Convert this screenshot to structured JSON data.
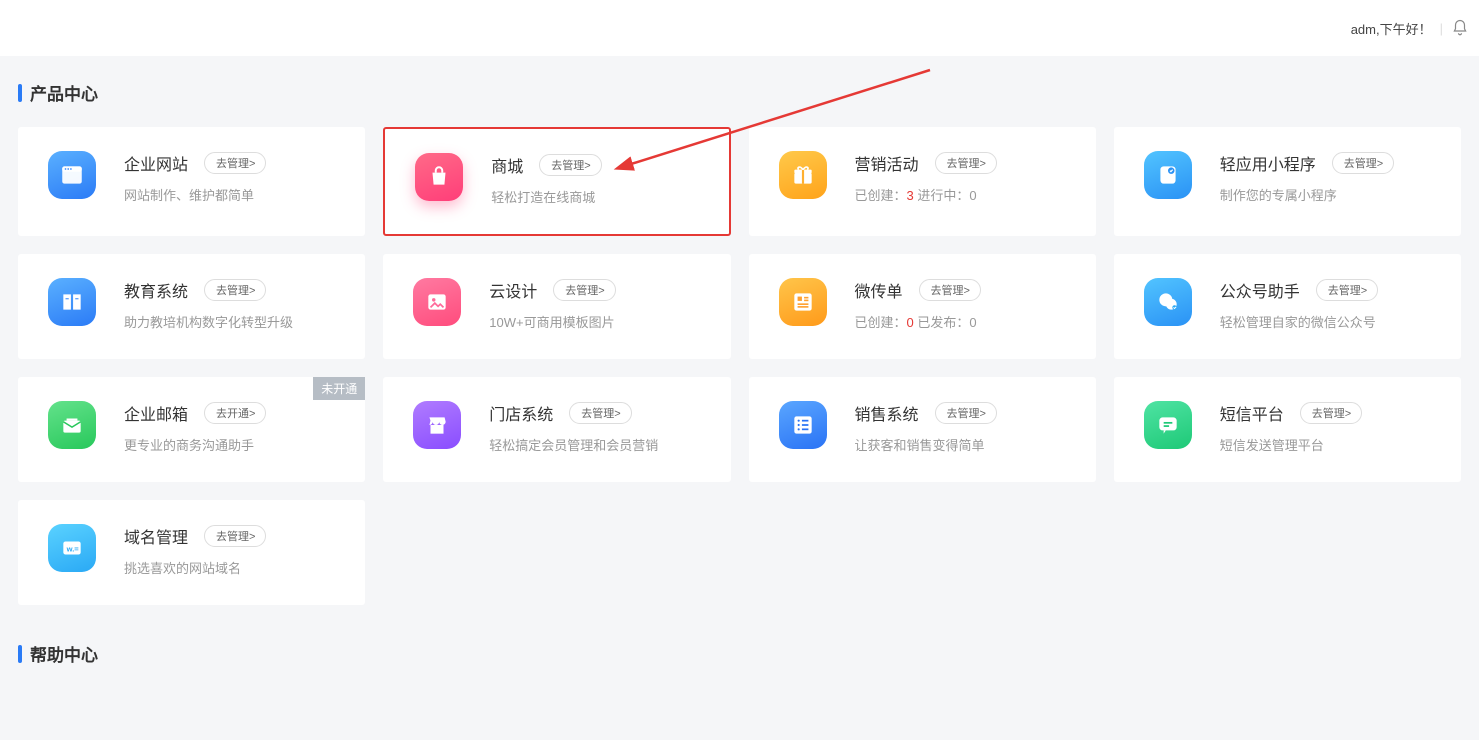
{
  "header": {
    "greeting": "adm,下午好！"
  },
  "sections": {
    "product_center": "产品中心",
    "help_center": "帮助中心"
  },
  "badge_unopened": "未开通",
  "products": [
    {
      "id": "enterprise-website",
      "title": "企业网站",
      "btn": "去管理>",
      "sub": "网站制作、维护都简单",
      "icon": "site",
      "bg": "bg-blue"
    },
    {
      "id": "mall",
      "title": "商城",
      "btn": "去管理>",
      "sub": "轻松打造在线商城",
      "icon": "bag",
      "bg": "bg-pink",
      "highlight": true
    },
    {
      "id": "marketing",
      "title": "营销活动",
      "btn": "去管理>",
      "sub_parts": {
        "l1": "已创建：",
        "n1": "3",
        "l2": "  进行中：",
        "n2": "0"
      },
      "icon": "gift",
      "bg": "bg-orange"
    },
    {
      "id": "mini-program",
      "title": "轻应用小程序",
      "btn": "去管理>",
      "sub": "制作您的专属小程序",
      "icon": "app",
      "bg": "bg-cyan"
    },
    {
      "id": "education",
      "title": "教育系统",
      "btn": "去管理>",
      "sub": "助力教培机构数字化转型升级",
      "icon": "book",
      "bg": "bg-blue"
    },
    {
      "id": "cloud-design",
      "title": "云设计",
      "btn": "去管理>",
      "sub": "10W+可商用模板图片",
      "icon": "image",
      "bg": "bg-pink2"
    },
    {
      "id": "weichuandan",
      "title": "微传单",
      "btn": "去管理>",
      "sub_parts": {
        "l1": "已创建：",
        "n1": "0",
        "l2": "  已发布：",
        "n2": "0"
      },
      "icon": "news",
      "bg": "bg-orange2"
    },
    {
      "id": "wechat-helper",
      "title": "公众号助手",
      "btn": "去管理>",
      "sub": "轻松管理自家的微信公众号",
      "icon": "wechat",
      "bg": "bg-cyan"
    },
    {
      "id": "enterprise-mail",
      "title": "企业邮箱",
      "btn": "去开通>",
      "sub": "更专业的商务沟通助手",
      "icon": "mail",
      "bg": "bg-green",
      "unopened": true
    },
    {
      "id": "store-system",
      "title": "门店系统",
      "btn": "去管理>",
      "sub": "轻松搞定会员管理和会员营销",
      "icon": "store",
      "bg": "bg-purple"
    },
    {
      "id": "sales-system",
      "title": "销售系统",
      "btn": "去管理>",
      "sub": "让获客和销售变得简单",
      "icon": "list",
      "bg": "bg-blue3"
    },
    {
      "id": "sms",
      "title": "短信平台",
      "btn": "去管理>",
      "sub": "短信发送管理平台",
      "icon": "msg",
      "bg": "bg-green2"
    },
    {
      "id": "domain",
      "title": "域名管理",
      "btn": "去管理>",
      "sub": "挑选喜欢的网站域名",
      "icon": "domain",
      "bg": "bg-cyan2"
    }
  ]
}
